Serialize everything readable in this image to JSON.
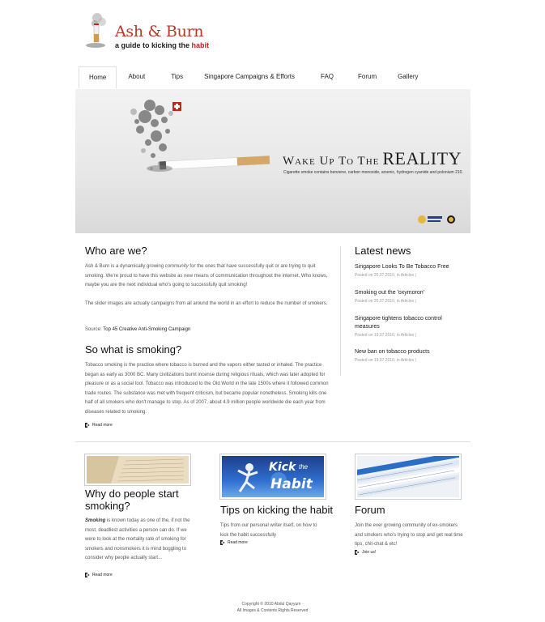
{
  "logo": {
    "name": "Ash & Burn",
    "tagline_prefix": "a guide to kicking the ",
    "tagline_highlight": "habit"
  },
  "nav": {
    "items": [
      {
        "label": "Home",
        "active": true
      },
      {
        "label": "About"
      },
      {
        "label": "Tips"
      },
      {
        "label": "Singapore Campaigns & Efforts"
      },
      {
        "label": "FAQ"
      },
      {
        "label": "Forum"
      },
      {
        "label": "Gallery"
      }
    ]
  },
  "banner": {
    "headline_sm1": "Wake up to the",
    "headline_big": "Reality",
    "subline": "Cigarette smoke contains benzene, carbon monoxide, arsenic, hydrogen cyanide and polonium 210."
  },
  "who": {
    "title": "Who are we?",
    "p1_a": "Ash & Burn is a dynamically growing ",
    "p1_em": "community",
    "p1_b": " for the ones that have successfully quit or are trying to quit smoking. We're proud to have this website as new means of communication throughout the internet. Who knows, maybe you are the next individual who's going to successfully quit smoking!",
    "p2": "The slider images are actually campaigns from all around the world in an effort to reduce the number of smokers.",
    "source_label": "Source: ",
    "source_link": "Top 45 Creative Anti-Smoking Campaign"
  },
  "what": {
    "title": "So what is smoking?",
    "body": "Tobacco smoking is the practice where tobacco is burned and the vapors either tasted or inhaled. The practice began as early as 3000 BC. Many civilizations burnt incense during religious rituals, which was later adopted for pleasure or as a social tool. Tobacco was introduced to the Old World in the late 1500s where it followed common trade routes. The substance was met with frequent criticism, but became popular nonetheless. Smoking kills one half of all smokers who don't manage to stop. As of 2007, about 4.9 million people worldwide die each year from diseases related to smoking.",
    "read_more": "Read more"
  },
  "news": {
    "title": "Latest news",
    "items": [
      {
        "title": "Singapore Looks To Be Tobacco Free",
        "meta": "Posted on 20.07.2010, in Articles |"
      },
      {
        "title": "Smoking out the 'oxymoron'",
        "meta": "Posted on 20.07.2010, in Articles |"
      },
      {
        "title": "Singapore tightens tobacco control measures",
        "meta": "Posted on 19.07.2010, in Articles |"
      },
      {
        "title": "New ban on tobacco products",
        "meta": "Posted on 19.07.2010, in Articles |"
      }
    ]
  },
  "features": [
    {
      "title": "Why do people start smoking?",
      "body_em": "Smoking",
      "body": " is known today as one of the, if not the most, deadliest activities a person can do. If we were to look at the mortality rate of smoking for smokers and nonsmokers it is mind boggling to consider why people actually start...",
      "link": "Read more"
    },
    {
      "title": "Tips on kicking the habit",
      "body": "Tips from our personal writer itself, on how to kick the habit successfully",
      "link": "Read more",
      "thumb_text_1": "Kick",
      "thumb_text_2": "the",
      "thumb_text_3": "Habit"
    },
    {
      "title": "Forum",
      "body": "Join the ever growing community of ex-smokers and smokers who's trying to stop and get real time tips, chit-chat & etc!",
      "link": "Join us!"
    }
  ],
  "footer": {
    "line1": "Copyright © 2010 Abdul Qayyum ·",
    "line2": "All Images & Contents Rights Reserved"
  },
  "colors": {
    "accent": "#c0261e",
    "text": "#333333"
  }
}
